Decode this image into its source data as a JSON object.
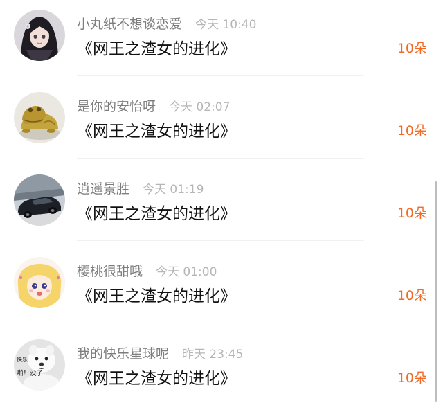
{
  "gift_list": [
    {
      "username": "小丸纸不想谈恋爱",
      "time": "今天 10:40",
      "book": "《网王之渣女的进化》",
      "gift": "10朵"
    },
    {
      "username": "是你的安怡呀",
      "time": "今天 02:07",
      "book": "《网王之渣女的进化》",
      "gift": "10朵"
    },
    {
      "username": "逍遥景胜",
      "time": "今天 01:19",
      "book": "《网王之渣女的进化》",
      "gift": "10朵"
    },
    {
      "username": "樱桃很甜哦",
      "time": "今天 01:00",
      "book": "《网王之渣女的进化》",
      "gift": "10朵"
    },
    {
      "username": "我的快乐星球呢",
      "time": "昨天 23:45",
      "book": "《网王之渣女的进化》",
      "gift": "10朵",
      "avatar_text": "快乐 啪！没了"
    }
  ],
  "colors": {
    "username": "#7d7d7d",
    "time": "#b6b6b6",
    "book": "#111111",
    "gift": "#f26a24",
    "divider": "#f1f1f1"
  }
}
